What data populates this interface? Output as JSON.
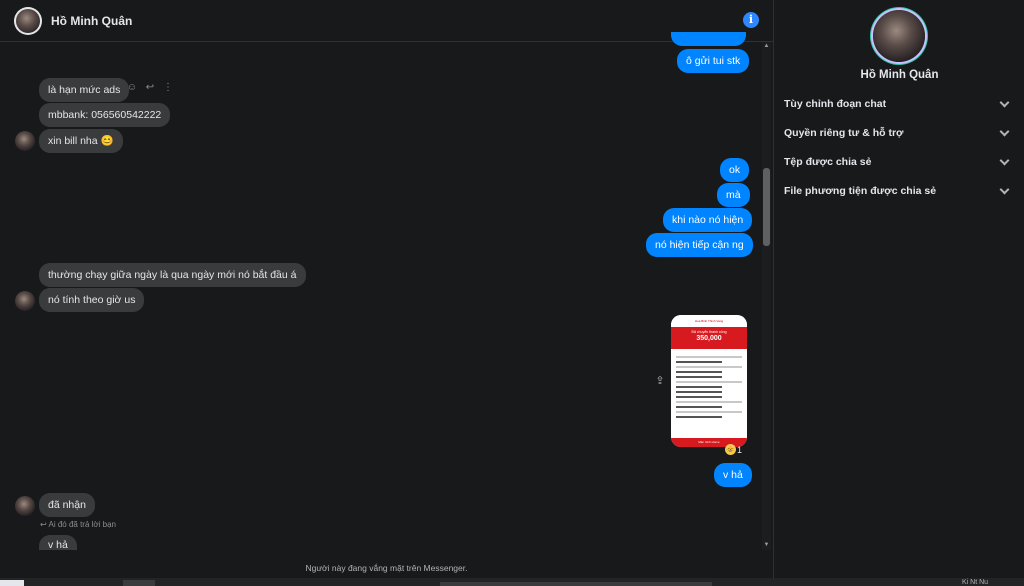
{
  "header": {
    "name": "Hồ Minh Quân",
    "info_icon": "i"
  },
  "messages": {
    "partial_top": "",
    "m1": "ô gửi tui stk",
    "m2": "là hạn mức ads",
    "m3": "mbbank: 056560542222",
    "m4": "xin bill nha 😊",
    "m5": "ok",
    "m6": "mà",
    "m7": "khi nào nó hiện",
    "m8": "nó hiện tiếp cận ng",
    "m9": "thường chạy giữa ngày là qua ngày mới nó bắt đầu á",
    "m10": "nó tính theo giờ us",
    "m11": "v hả",
    "m12": "đã nhận",
    "m13": "v hả"
  },
  "receipt": {
    "top": "Hoa Binh Thinh Vang",
    "label": "Đã chuyển thành công",
    "amount": "350,000",
    "button": "Màn hình Home"
  },
  "reaction": {
    "emoji": "😸",
    "count": "1"
  },
  "reply_note": "Ai đó đã trả lời bạn",
  "status": "Người này đang vắng mặt trên Messenger.",
  "info_panel": {
    "name": "Hồ Minh Quân",
    "items": [
      "Tùy chỉnh đoạn chat",
      "Quyền riêng tư & hỗ trợ",
      "Tệp được chia sẻ",
      "File phương tiện được chia sẻ"
    ]
  },
  "taskbar": {
    "text": "Ki Nt Nu"
  },
  "colors": {
    "outgoing": "#0084ff",
    "incoming": "#3a3b3c",
    "background": "#18191a",
    "accent": "#2d88ff"
  }
}
